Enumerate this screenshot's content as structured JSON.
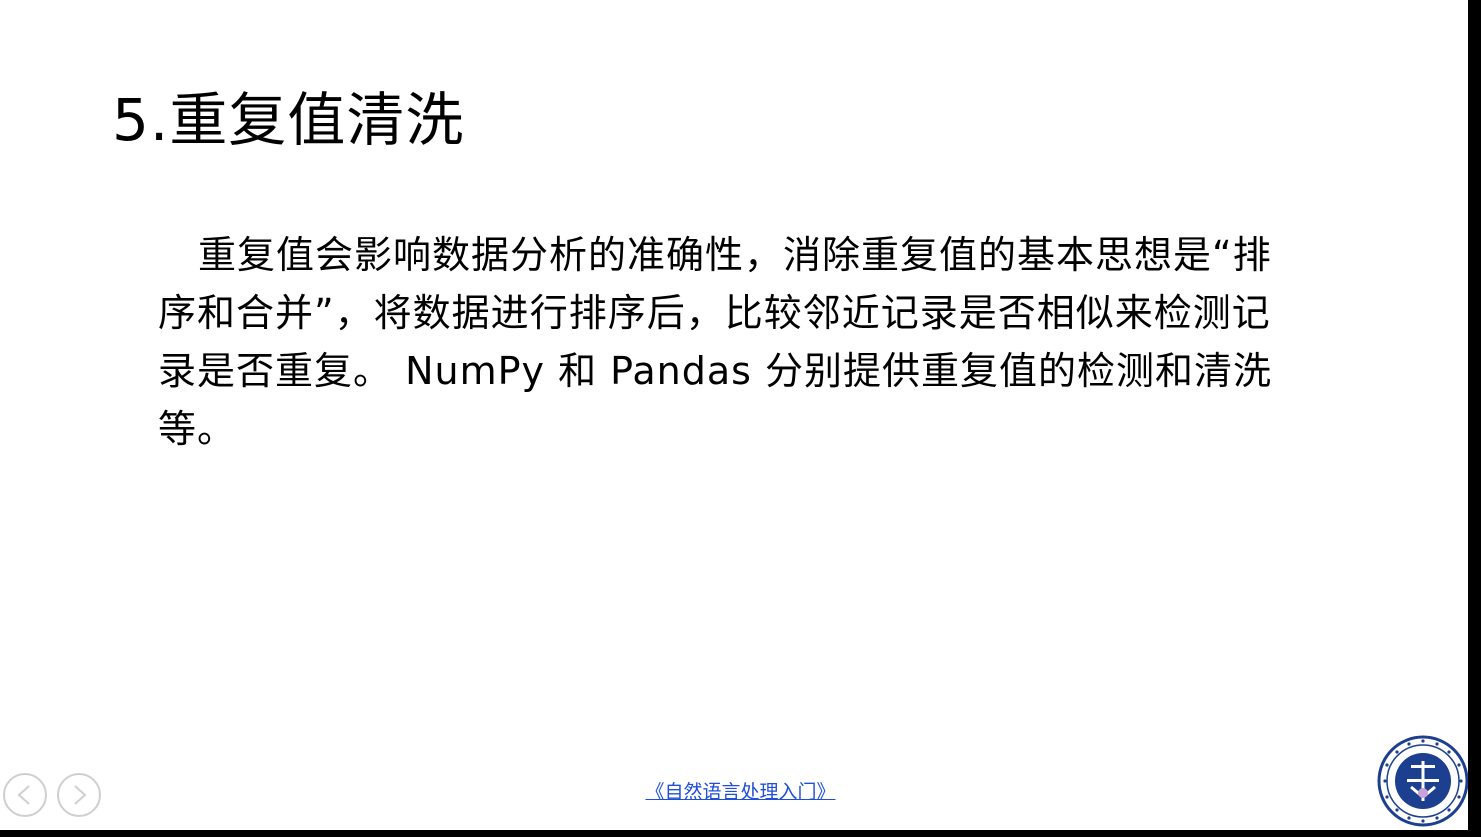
{
  "slide": {
    "title": "5.重复值清洗",
    "body": "重复值会影响数据分析的准确性，消除重复值的基本思想是“排序和合并”，将数据进行排序后，比较邻近记录是否相似来检测记录是否重复。 NumPy 和 Pandas 分别提供重复值的检测和清洗等。"
  },
  "footer": {
    "link_text": "《自然语言处理入门》"
  },
  "nav": {
    "prev_icon": "chevron-left-icon",
    "next_icon": "chevron-right-icon"
  },
  "logo": {
    "icon": "university-seal-icon",
    "ring_color": "#1d3f8f"
  }
}
